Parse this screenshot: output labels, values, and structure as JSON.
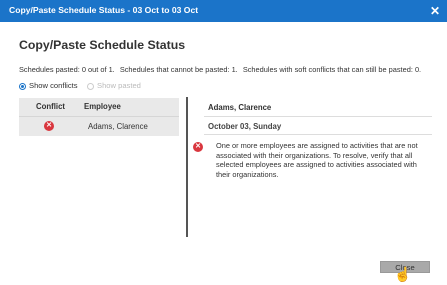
{
  "window": {
    "title": "Copy/Paste Schedule Status - 03 Oct to 03 Oct",
    "close_glyph": "✕"
  },
  "heading": "Copy/Paste Schedule Status",
  "summary": {
    "pasted": "Schedules pasted: 0 out of 1.",
    "cannot_paste": "Schedules that cannot be pasted: 1.",
    "soft_conflicts": "Schedules with soft conflicts that can still be pasted: 0."
  },
  "radios": [
    {
      "label": "Show conflicts",
      "checked": true
    },
    {
      "label": "Show pasted",
      "checked": false
    }
  ],
  "table": {
    "columns": [
      "Conflict",
      "Employee"
    ],
    "rows": [
      {
        "conflict_icon": "error-icon",
        "employee": "Adams, Clarence"
      }
    ]
  },
  "detail": {
    "employee": "Adams, Clarence",
    "date": "October 03, Sunday",
    "message": "One or more employees are assigned to activities that are not associated with their organizations. To resolve, verify that all selected employees are assigned to activities associated with their organizations."
  },
  "buttons": {
    "close": "Close"
  },
  "colors": {
    "titlebar": "#1b74c9",
    "error": "#d9363e"
  }
}
